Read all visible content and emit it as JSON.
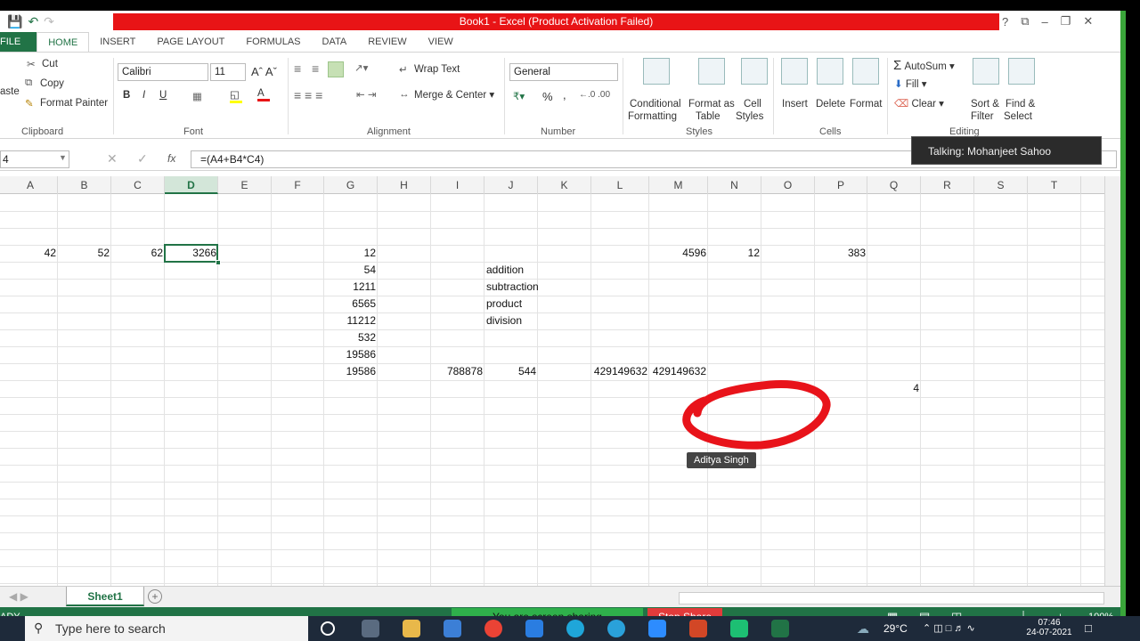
{
  "title_bar": {
    "title": "Book1 -  Excel (Product Activation Failed)",
    "help": "?",
    "window_buttons": [
      "⧉",
      "–",
      "❐",
      "✕"
    ]
  },
  "tabs": [
    "FILE",
    "HOME",
    "INSERT",
    "PAGE LAYOUT",
    "FORMULAS",
    "DATA",
    "REVIEW",
    "VIEW"
  ],
  "active_tab": "HOME",
  "ribbon": {
    "clipboard": {
      "paste": "aste",
      "cut": "Cut",
      "copy": "Copy",
      "format_painter": "Format Painter",
      "label": "Clipboard"
    },
    "font": {
      "name": "Calibri",
      "size": "11",
      "bold": "B",
      "italic": "I",
      "underline": "U",
      "label": "Font"
    },
    "alignment": {
      "wrap_text": "Wrap Text",
      "merge_center": "Merge & Center",
      "label": "Alignment"
    },
    "number": {
      "format": "General",
      "percent": "%",
      "comma": ",",
      "label": "Number"
    },
    "styles": {
      "conditional": "Conditional",
      "conditional2": "Formatting",
      "format_table": "Format as",
      "format_table2": "Table",
      "cell_styles": "Cell",
      "cell_styles2": "Styles",
      "label": "Styles"
    },
    "cells": {
      "insert": "Insert",
      "delete": "Delete",
      "format": "Format",
      "label": "Cells"
    },
    "editing": {
      "autosum": "AutoSum",
      "fill": "Fill",
      "clear": "Clear",
      "sort_filter": "Sort &",
      "sort_filter2": "Filter",
      "find_select": "Find &",
      "find_select2": "Select",
      "label": "Editing"
    }
  },
  "formula_bar": {
    "name_box": "4",
    "fx": "fx",
    "formula": "=(A4+B4*C4)"
  },
  "talking": "Talking: Mohanjeet Sahoo",
  "columns": [
    "A",
    "B",
    "C",
    "D",
    "E",
    "F",
    "G",
    "H",
    "I",
    "J",
    "K",
    "L",
    "M",
    "N",
    "O",
    "P",
    "Q",
    "R",
    "S",
    "T"
  ],
  "selected_column": "D",
  "cells": [
    {
      "col": "A",
      "row": 4,
      "v": "42",
      "align": "right"
    },
    {
      "col": "B",
      "row": 4,
      "v": "52",
      "align": "right"
    },
    {
      "col": "C",
      "row": 4,
      "v": "62",
      "align": "right"
    },
    {
      "col": "D",
      "row": 4,
      "v": "3266",
      "align": "right"
    },
    {
      "col": "G",
      "row": 4,
      "v": "12",
      "align": "right"
    },
    {
      "col": "M",
      "row": 4,
      "v": "4596",
      "align": "right"
    },
    {
      "col": "N",
      "row": 4,
      "v": "12",
      "align": "right"
    },
    {
      "col": "P",
      "row": 4,
      "v": "383",
      "align": "right"
    },
    {
      "col": "G",
      "row": 5,
      "v": "54",
      "align": "right"
    },
    {
      "col": "J",
      "row": 5,
      "v": "addition",
      "align": "left"
    },
    {
      "col": "G",
      "row": 6,
      "v": "1211",
      "align": "right"
    },
    {
      "col": "J",
      "row": 6,
      "v": "subtraction",
      "align": "left"
    },
    {
      "col": "G",
      "row": 7,
      "v": "6565",
      "align": "right"
    },
    {
      "col": "J",
      "row": 7,
      "v": "product",
      "align": "left"
    },
    {
      "col": "G",
      "row": 8,
      "v": "11212",
      "align": "right"
    },
    {
      "col": "J",
      "row": 8,
      "v": "division",
      "align": "left"
    },
    {
      "col": "G",
      "row": 9,
      "v": "532",
      "align": "right"
    },
    {
      "col": "G",
      "row": 10,
      "v": "19586",
      "align": "right"
    },
    {
      "col": "G",
      "row": 11,
      "v": "19586",
      "align": "right"
    },
    {
      "col": "I",
      "row": 11,
      "v": "788878",
      "align": "right"
    },
    {
      "col": "J",
      "row": 11,
      "v": "544",
      "align": "right"
    },
    {
      "col": "L",
      "row": 11,
      "v": "429149632",
      "align": "right"
    },
    {
      "col": "M",
      "row": 11,
      "v": "429149632",
      "align": "right"
    },
    {
      "col": "Q",
      "row": 12,
      "v": "4",
      "align": "right"
    }
  ],
  "selected_cell": {
    "col": "D",
    "row": 4
  },
  "annotation_label": "Aditya Singh",
  "annotation_color": "#e8131a",
  "sheet_tab": "Sheet1",
  "status": {
    "ready": "ADY",
    "sharing": "You are screen sharing",
    "stop_share": "Stop Share",
    "zoom": "100%"
  },
  "taskbar": {
    "search_placeholder": "Type here to search",
    "temperature": "29°C",
    "time": "07:46",
    "date": "24-07-2021"
  },
  "colors": {
    "excel_green": "#217346",
    "title_red": "#e81416",
    "share_green": "#2fb04b",
    "stop_red": "#e23b3b"
  }
}
